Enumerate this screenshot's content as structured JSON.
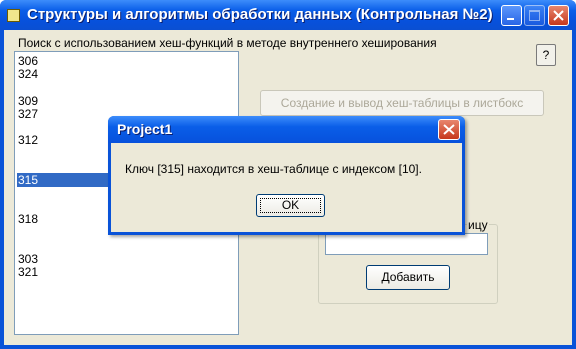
{
  "window": {
    "title": "Структуры и алгоритмы обработки данных (Контрольная №2)",
    "icons": [
      "app-icon",
      "minimize-icon",
      "maximize-icon",
      "close-icon"
    ]
  },
  "main": {
    "group_caption": "Поиск с использованием хеш-функций в методе внутреннего хеширования",
    "help_label": "?",
    "list_items": [
      "306",
      "324",
      "",
      "309",
      "327",
      "",
      "312",
      "",
      "",
      "315",
      "",
      "",
      "318",
      "",
      "",
      "303",
      "321"
    ],
    "selected_item": "315",
    "create_button_label": "Создание и вывод хеш-таблицы в листбокс",
    "search_group_caption": "ицу",
    "key_input_value": "",
    "add_button_label": "Добавить"
  },
  "dialog": {
    "title": "Project1",
    "message": "Ключ [315] находится в хеш-таблице с индексом [10].",
    "ok_label": "OK"
  },
  "colors": {
    "titlebar": "#0a5ee8",
    "selection": "#316ac5",
    "client_bg": "#ece9d8",
    "close_button": "#c6381d"
  }
}
